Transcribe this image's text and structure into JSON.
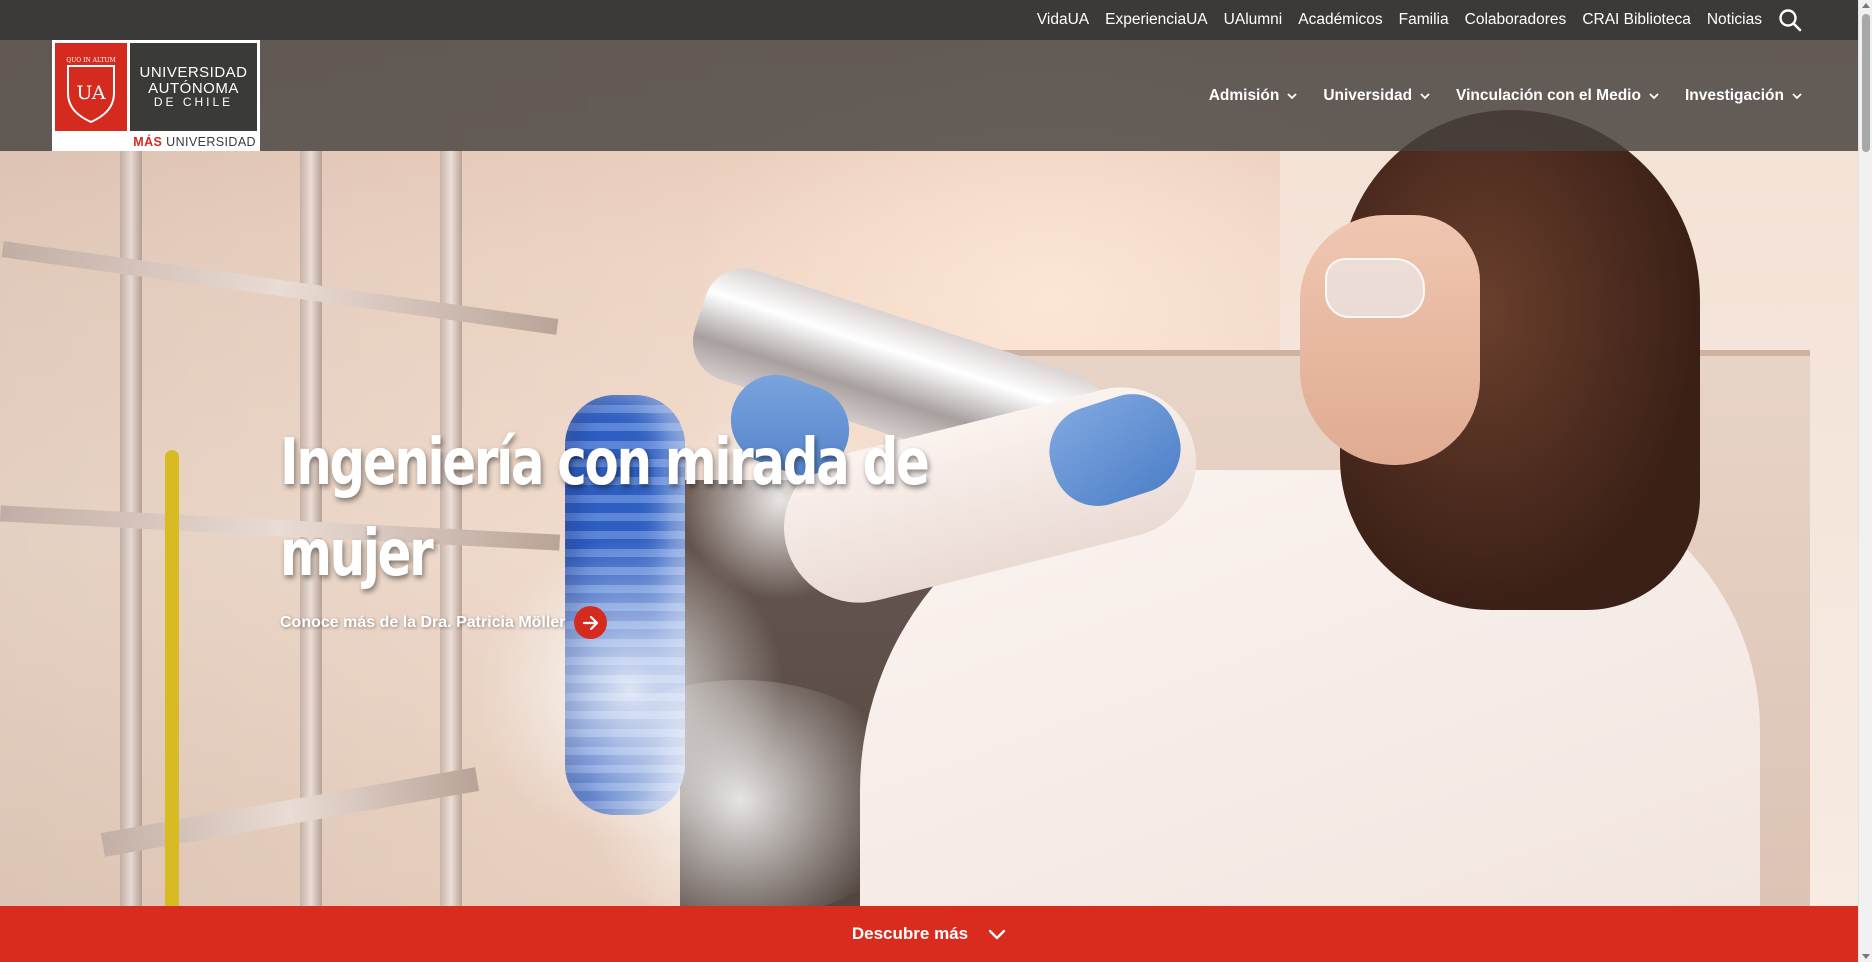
{
  "utility_nav": {
    "items": [
      {
        "label": "VidaUA"
      },
      {
        "label": "ExperienciaUA"
      },
      {
        "label": "UAlumni"
      },
      {
        "label": "Académicos"
      },
      {
        "label": "Familia"
      },
      {
        "label": "Colaboradores"
      },
      {
        "label": "CRAI Biblioteca"
      },
      {
        "label": "Noticias"
      }
    ],
    "search_icon": "search-icon"
  },
  "logo": {
    "shield_text": "UA",
    "motto": "QUO IN ALTUM",
    "line1": "UNIVERSIDAD",
    "line2": "AUTÓNOMA",
    "line3": "DE CHILE",
    "slogan_accent": "MÁS",
    "slogan_rest": "UNIVERSIDAD"
  },
  "main_nav": {
    "items": [
      {
        "label": "Admisión"
      },
      {
        "label": "Universidad"
      },
      {
        "label": "Vinculación con el Medio"
      },
      {
        "label": "Investigación"
      }
    ]
  },
  "hero": {
    "title": "Ingeniería con mirada de mujer",
    "link_label": "Conoce más de la Dra. Patricia Möller",
    "link_icon": "arrow-right-icon"
  },
  "cta": {
    "label": "Descubre más",
    "icon": "chevron-down-icon"
  },
  "colors": {
    "brand_red": "#d52b1e",
    "utility_bar": "#3b3a38",
    "nav_overlay": "#464240"
  }
}
